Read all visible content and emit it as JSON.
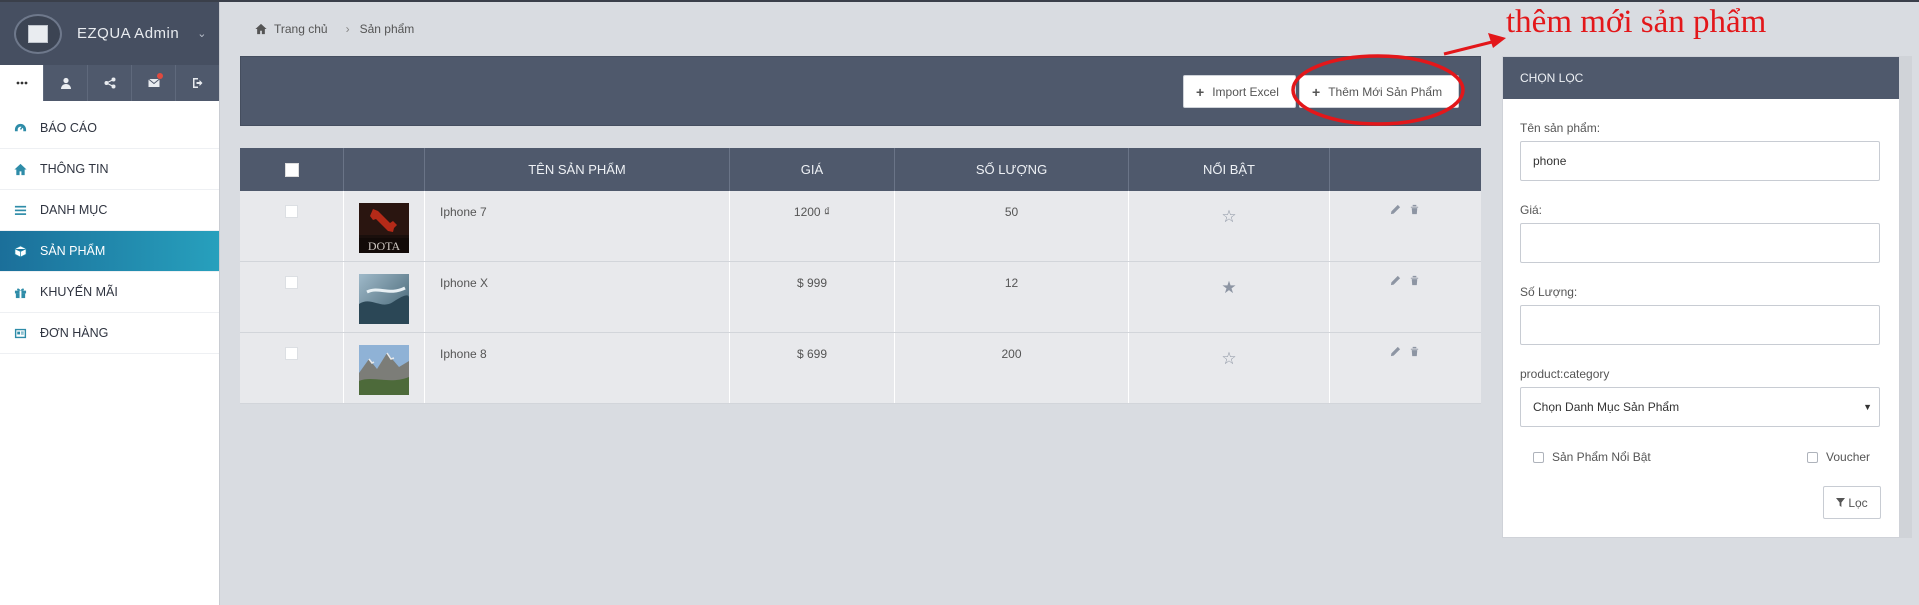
{
  "app": {
    "brand_name": "EZQUA Admin"
  },
  "colors": {
    "header_bg": "#4f596c",
    "active_menu": "#27a0bd",
    "annotation": "#e3171a"
  },
  "iconbar": [
    {
      "icon": "more-icon",
      "active": true
    },
    {
      "icon": "user-icon"
    },
    {
      "icon": "share-icon"
    },
    {
      "icon": "mail-icon",
      "badge": true
    },
    {
      "icon": "logout-icon"
    }
  ],
  "menu": [
    {
      "label": "BÁO CÁO",
      "icon": "dashboard-icon"
    },
    {
      "label": "THÔNG TIN",
      "icon": "home-icon"
    },
    {
      "label": "DANH MỤC",
      "icon": "list-icon"
    },
    {
      "label": "SẢN PHẨM",
      "icon": "cube-icon",
      "active": true
    },
    {
      "label": "KHUYẾN MÃI",
      "icon": "gift-icon"
    },
    {
      "label": "ĐƠN HÀNG",
      "icon": "order-icon"
    }
  ],
  "breadcrumb": {
    "home": "Trang chủ",
    "current": "Sản phẩm"
  },
  "toolbar": {
    "import_label": "Import Excel",
    "add_label": "Thêm Mới Sản Phẩm"
  },
  "table": {
    "headers": [
      "TÊN SẢN PHẨM",
      "GIÁ",
      "SỐ LƯỢNG",
      "NỔI BẬT"
    ],
    "rows": [
      {
        "name": "Iphone 7",
        "price": "1200 ₫",
        "qty": "50",
        "featured": false,
        "thumb": "dota-logo"
      },
      {
        "name": "Iphone X",
        "price": "$ 999",
        "qty": "12",
        "featured": true,
        "thumb": "landscape-aerial"
      },
      {
        "name": "Iphone 8",
        "price": "$ 699",
        "qty": "200",
        "featured": false,
        "thumb": "mountain-valley"
      }
    ]
  },
  "filter": {
    "title": "CHỌN LỌC",
    "name_label": "Tên sản phẩm:",
    "name_value": "phone",
    "price_label": "Giá:",
    "price_value": "",
    "qty_label": "Số Lượng:",
    "qty_value": "",
    "category_label": "product:category",
    "category_selected": "Chọn Danh Mục Sản Phẩm",
    "featured_checkbox": "Sản Phẩm Nổi Bật",
    "voucher_checkbox": "Voucher",
    "filter_button": "Lọc"
  },
  "annotation": {
    "text": "thêm mới sản phẩm"
  }
}
